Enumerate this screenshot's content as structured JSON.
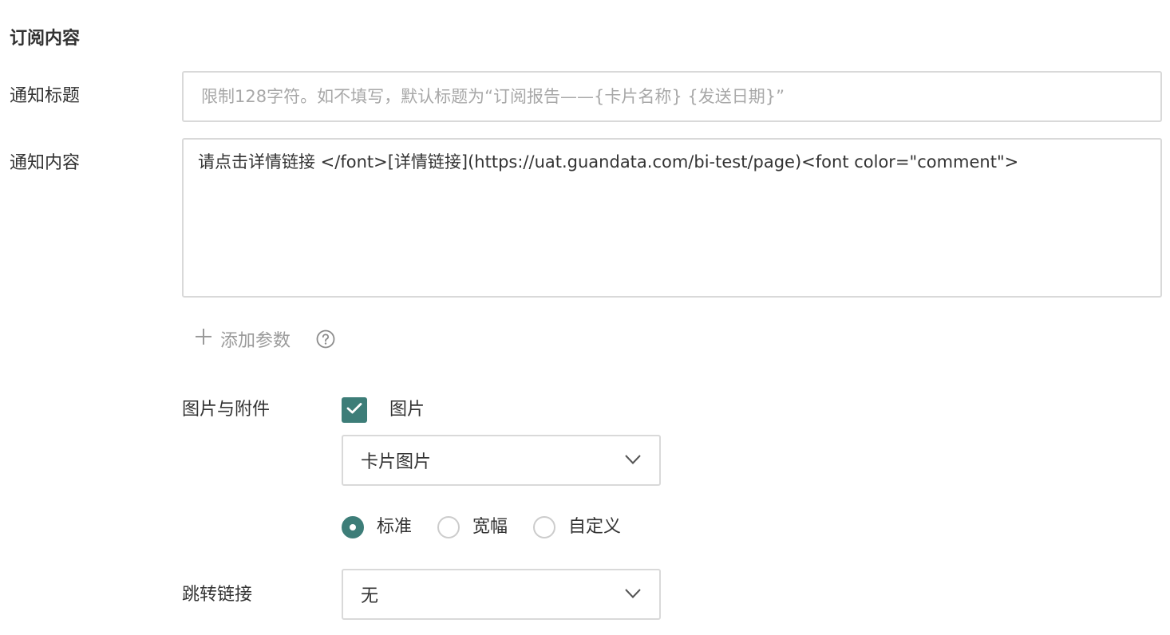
{
  "section": {
    "title": "订阅内容"
  },
  "notification_title": {
    "label": "通知标题",
    "value": "",
    "placeholder": "限制128字符。如不填写，默认标题为“订阅报告——{卡片名称} {发送日期}”"
  },
  "notification_content": {
    "label": "通知内容",
    "value": "请点击详情链接 </font>[详情链接](https://uat.guandata.com/bi-test/page)<font color=\"comment\">"
  },
  "add_param": {
    "label": "添加参数",
    "icon": "plus-icon",
    "help_icon": "question-circle-icon"
  },
  "attachments": {
    "label": "图片与附件",
    "image_checkbox": {
      "label": "图片",
      "checked": true
    },
    "image_type": {
      "selected": "卡片图片",
      "icon": "chevron-down-icon"
    },
    "size_options": [
      {
        "label": "标准",
        "checked": true
      },
      {
        "label": "宽幅",
        "checked": false
      },
      {
        "label": "自定义",
        "checked": false
      }
    ]
  },
  "jump_link": {
    "label": "跳转链接",
    "selected": "无",
    "icon": "chevron-down-icon"
  },
  "colors": {
    "accent": "#3d7d78",
    "border": "#d9d9d9",
    "placeholder": "#a8a8a8",
    "text": "#333333"
  }
}
